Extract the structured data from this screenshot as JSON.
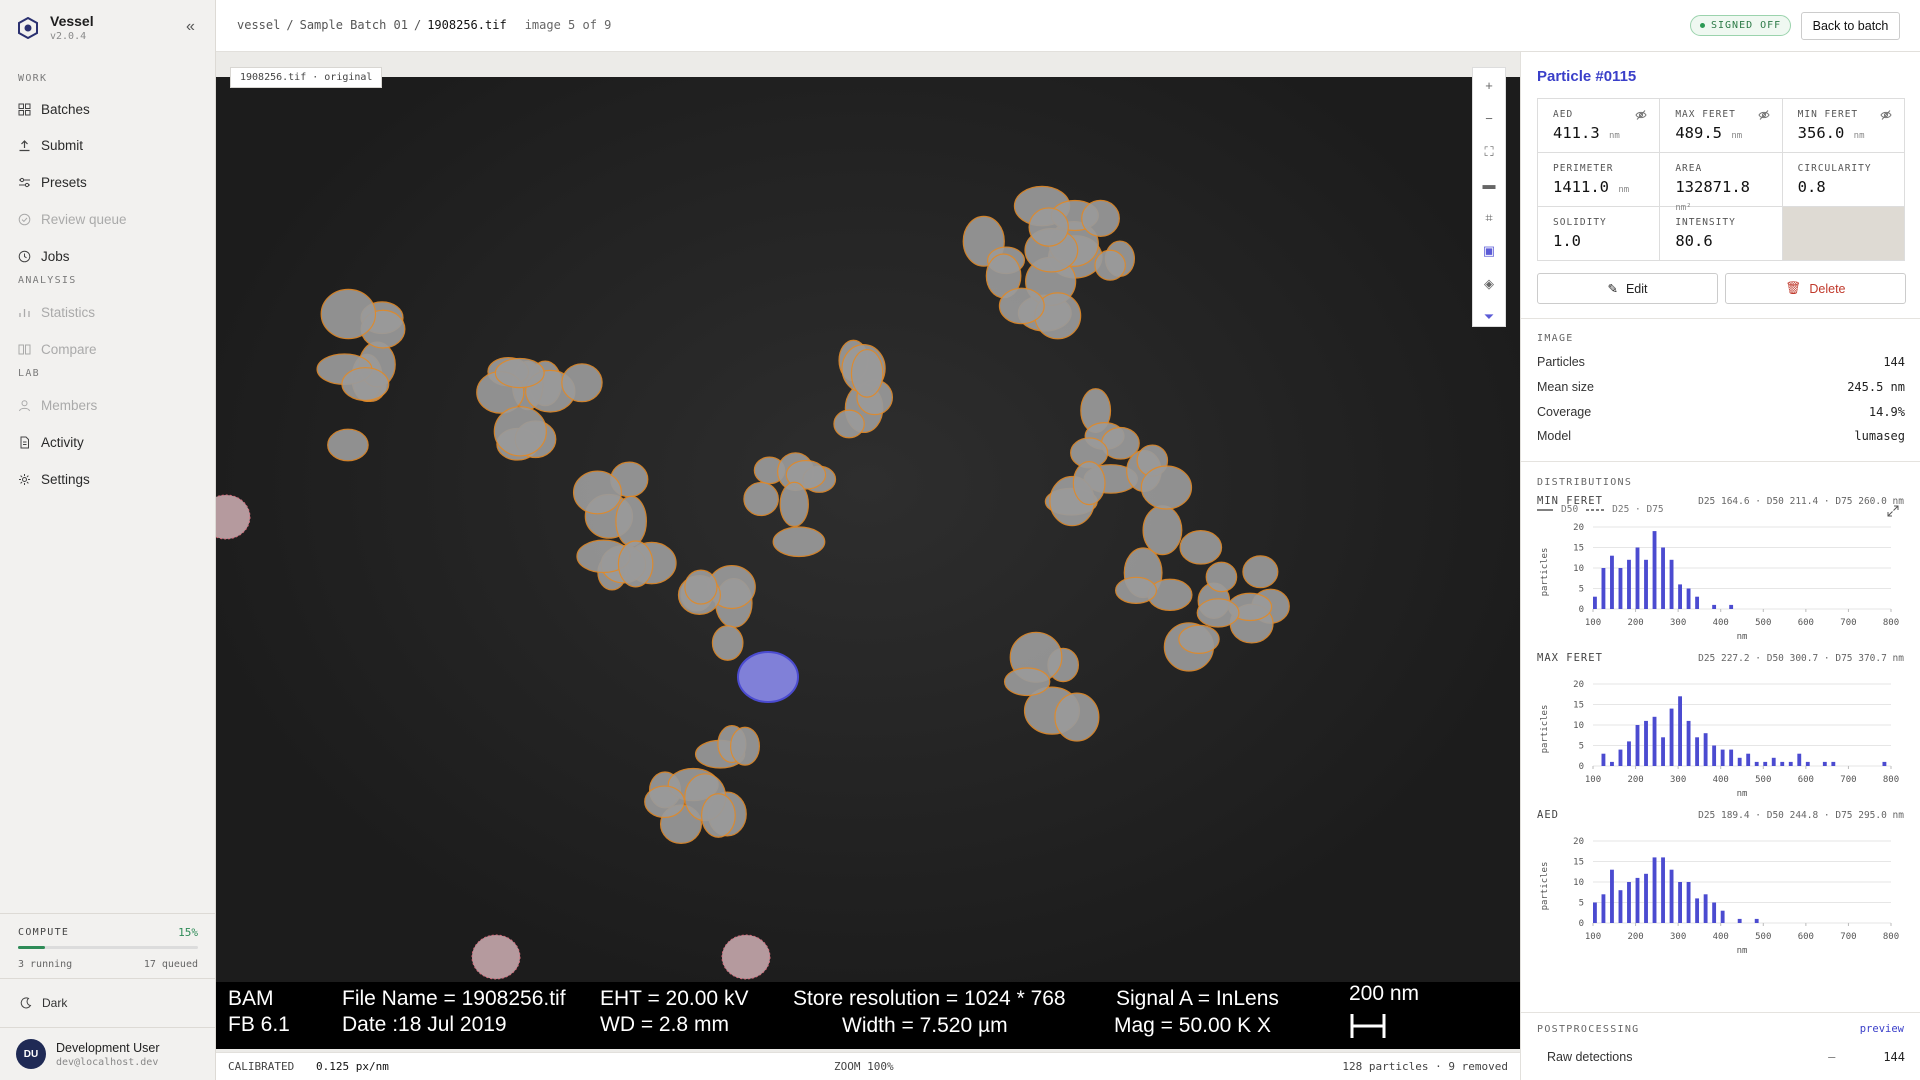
{
  "app": {
    "name": "Vessel",
    "version": "v2.0.4"
  },
  "sidebar": {
    "sections": {
      "work": "WORK",
      "analysis": "ANALYSIS",
      "lab": "LAB"
    },
    "items": [
      {
        "label": "Batches",
        "icon": "grid-icon",
        "enabled": true
      },
      {
        "label": "Submit",
        "icon": "upload-icon",
        "enabled": true
      },
      {
        "label": "Presets",
        "icon": "sliders-icon",
        "enabled": true
      },
      {
        "label": "Review queue",
        "icon": "check-circle-icon",
        "enabled": false
      },
      {
        "label": "Jobs",
        "icon": "clock-icon",
        "enabled": true
      },
      {
        "label": "Statistics",
        "icon": "bar-chart-icon",
        "enabled": false
      },
      {
        "label": "Compare",
        "icon": "columns-icon",
        "enabled": false
      },
      {
        "label": "Members",
        "icon": "user-icon",
        "enabled": false
      },
      {
        "label": "Activity",
        "icon": "document-icon",
        "enabled": true
      },
      {
        "label": "Settings",
        "icon": "gear-icon",
        "enabled": true
      }
    ],
    "compute": {
      "label": "COMPUTE",
      "percent": "15%",
      "fraction": 0.15,
      "running": "3 running",
      "queued": "17 queued"
    },
    "theme_label": "Dark",
    "user": {
      "initials": "DU",
      "name": "Development User",
      "email": "dev@localhost.dev"
    }
  },
  "topbar": {
    "breadcrumb": [
      "vessel",
      "Sample Batch 01",
      "1908256.tif"
    ],
    "sep": "/",
    "image_count": "image 5 of 9",
    "status": "SIGNED OFF",
    "back_label": "Back to batch"
  },
  "viewer": {
    "file_tag": "1908256.tif · original",
    "tools": [
      "zoom-in-icon",
      "zoom-out-icon",
      "fit-icon",
      "ruler-icon",
      "crop-icon",
      "image-icon",
      "layers-icon",
      "filter-icon"
    ],
    "infobar": {
      "bam": "BAM",
      "fb": "FB 6.1",
      "file": "File Name = 1908256.tif",
      "date": "Date :18 Jul 2019",
      "eht": "EHT = 20.00 kV",
      "wd": "WD =  2.8 mm",
      "store": "Store resolution = 1024 * 768",
      "width": "Width = 7.520 µm",
      "signal": "Signal A = InLens",
      "mag": "Mag =   50.00 K X",
      "scale": "200 nm"
    },
    "status": {
      "calibrated": "CALIBRATED",
      "scale": "0.125 px/nm",
      "zoom": "ZOOM 100%",
      "particles": "128 particles · 9 removed"
    }
  },
  "panel": {
    "title": "Particle #0115",
    "metrics": [
      {
        "label": "AED",
        "value": "411.3",
        "unit": "nm",
        "hide": true
      },
      {
        "label": "MAX FERET",
        "value": "489.5",
        "unit": "nm",
        "hide": true
      },
      {
        "label": "MIN FERET",
        "value": "356.0",
        "unit": "nm",
        "hide": true
      },
      {
        "label": "PERIMETER",
        "value": "1411.0",
        "unit": "nm",
        "hide": false
      },
      {
        "label": "AREA",
        "value": "132871.8",
        "unit": "nm²",
        "hide": false
      },
      {
        "label": "CIRCULARITY",
        "value": "0.8",
        "unit": "",
        "hide": false
      },
      {
        "label": "SOLIDITY",
        "value": "1.0",
        "unit": "",
        "hide": false
      },
      {
        "label": "INTENSITY",
        "value": "80.6",
        "unit": "",
        "hide": false
      }
    ],
    "edit_label": "Edit",
    "delete_label": "Delete",
    "image": {
      "heading": "IMAGE",
      "rows": [
        {
          "label": "Particles",
          "value": "144"
        },
        {
          "label": "Mean size",
          "value": "245.5 nm"
        },
        {
          "label": "Coverage",
          "value": "14.9%"
        },
        {
          "label": "Model",
          "value": "lumaseg"
        }
      ]
    },
    "distributions": {
      "heading": "DISTRIBUTIONS",
      "legend_d50": "D50",
      "legend_d25": "D25 · D75"
    },
    "postprocessing": {
      "heading": "POSTPROCESSING",
      "preview": "preview",
      "row_label": "Raw detections",
      "row_dash": "—",
      "row_value": "144"
    }
  },
  "chart_data": [
    {
      "type": "bar",
      "title": "MIN FERET",
      "stats": "D25 164.6 · D50 211.4 · D75 260.0 nm",
      "xlabel": "nm",
      "ylabel": "particles",
      "x_ticks": [
        100,
        200,
        300,
        400,
        500,
        600,
        700,
        800
      ],
      "y_ticks": [
        0,
        5,
        10,
        15,
        20
      ],
      "xlim": [
        100,
        800
      ],
      "ylim": [
        0,
        20
      ],
      "bin_width": 20,
      "bins": [
        {
          "x": 100,
          "y": 3
        },
        {
          "x": 120,
          "y": 10
        },
        {
          "x": 140,
          "y": 13
        },
        {
          "x": 160,
          "y": 10
        },
        {
          "x": 180,
          "y": 12
        },
        {
          "x": 200,
          "y": 15
        },
        {
          "x": 220,
          "y": 12
        },
        {
          "x": 240,
          "y": 19
        },
        {
          "x": 260,
          "y": 15
        },
        {
          "x": 280,
          "y": 12
        },
        {
          "x": 300,
          "y": 6
        },
        {
          "x": 320,
          "y": 5
        },
        {
          "x": 340,
          "y": 3
        },
        {
          "x": 380,
          "y": 1
        },
        {
          "x": 420,
          "y": 1
        }
      ]
    },
    {
      "type": "bar",
      "title": "MAX FERET",
      "stats": "D25 227.2 · D50 300.7 · D75 370.7 nm",
      "xlabel": "nm",
      "ylabel": "particles",
      "x_ticks": [
        100,
        200,
        300,
        400,
        500,
        600,
        700,
        800
      ],
      "y_ticks": [
        0,
        5,
        10,
        15,
        20
      ],
      "xlim": [
        100,
        800
      ],
      "ylim": [
        0,
        20
      ],
      "bin_width": 20,
      "bins": [
        {
          "x": 120,
          "y": 3
        },
        {
          "x": 140,
          "y": 1
        },
        {
          "x": 160,
          "y": 4
        },
        {
          "x": 180,
          "y": 6
        },
        {
          "x": 200,
          "y": 10
        },
        {
          "x": 220,
          "y": 11
        },
        {
          "x": 240,
          "y": 12
        },
        {
          "x": 260,
          "y": 7
        },
        {
          "x": 280,
          "y": 14
        },
        {
          "x": 300,
          "y": 17
        },
        {
          "x": 320,
          "y": 11
        },
        {
          "x": 340,
          "y": 7
        },
        {
          "x": 360,
          "y": 8
        },
        {
          "x": 380,
          "y": 5
        },
        {
          "x": 400,
          "y": 4
        },
        {
          "x": 420,
          "y": 4
        },
        {
          "x": 440,
          "y": 2
        },
        {
          "x": 460,
          "y": 3
        },
        {
          "x": 480,
          "y": 1
        },
        {
          "x": 500,
          "y": 1
        },
        {
          "x": 520,
          "y": 2
        },
        {
          "x": 540,
          "y": 1
        },
        {
          "x": 560,
          "y": 1
        },
        {
          "x": 580,
          "y": 3
        },
        {
          "x": 600,
          "y": 1
        },
        {
          "x": 640,
          "y": 1
        },
        {
          "x": 660,
          "y": 1
        },
        {
          "x": 780,
          "y": 1
        }
      ]
    },
    {
      "type": "bar",
      "title": "AED",
      "stats": "D25 189.4 · D50 244.8 · D75 295.0 nm",
      "xlabel": "nm",
      "ylabel": "particles",
      "x_ticks": [
        100,
        200,
        300,
        400,
        500,
        600,
        700,
        800
      ],
      "y_ticks": [
        0,
        5,
        10,
        15,
        20
      ],
      "xlim": [
        100,
        800
      ],
      "ylim": [
        0,
        20
      ],
      "bin_width": 20,
      "bins": [
        {
          "x": 100,
          "y": 5
        },
        {
          "x": 120,
          "y": 7
        },
        {
          "x": 140,
          "y": 13
        },
        {
          "x": 160,
          "y": 8
        },
        {
          "x": 180,
          "y": 10
        },
        {
          "x": 200,
          "y": 11
        },
        {
          "x": 220,
          "y": 12
        },
        {
          "x": 240,
          "y": 16
        },
        {
          "x": 260,
          "y": 16
        },
        {
          "x": 280,
          "y": 13
        },
        {
          "x": 300,
          "y": 10
        },
        {
          "x": 320,
          "y": 10
        },
        {
          "x": 340,
          "y": 6
        },
        {
          "x": 360,
          "y": 7
        },
        {
          "x": 380,
          "y": 5
        },
        {
          "x": 400,
          "y": 3
        },
        {
          "x": 440,
          "y": 1
        },
        {
          "x": 480,
          "y": 1
        }
      ]
    }
  ]
}
